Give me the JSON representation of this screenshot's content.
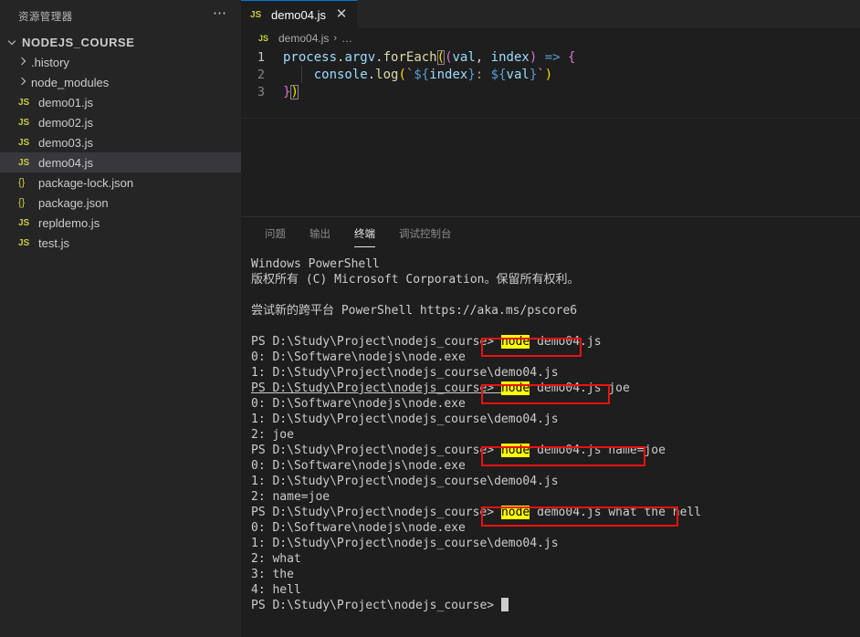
{
  "sidebar": {
    "title": "资源管理器",
    "more_icon": "ellipsis-icon",
    "root": {
      "label": "NODEJS_COURSE",
      "expanded": true
    },
    "items": [
      {
        "label": ".history",
        "kind": "folder",
        "icon": "chevron-right-icon"
      },
      {
        "label": "node_modules",
        "kind": "folder",
        "icon": "chevron-right-icon"
      },
      {
        "label": "demo01.js",
        "kind": "js",
        "icon": "js-file-icon",
        "badge": "JS"
      },
      {
        "label": "demo02.js",
        "kind": "js",
        "icon": "js-file-icon",
        "badge": "JS"
      },
      {
        "label": "demo03.js",
        "kind": "js",
        "icon": "js-file-icon",
        "badge": "JS"
      },
      {
        "label": "demo04.js",
        "kind": "js",
        "icon": "js-file-icon",
        "badge": "JS",
        "selected": true
      },
      {
        "label": "package-lock.json",
        "kind": "json",
        "icon": "json-file-icon",
        "badge": "{}"
      },
      {
        "label": "package.json",
        "kind": "json",
        "icon": "json-file-icon",
        "badge": "{}"
      },
      {
        "label": "repldemo.js",
        "kind": "js",
        "icon": "js-file-icon",
        "badge": "JS"
      },
      {
        "label": "test.js",
        "kind": "js",
        "icon": "js-file-icon",
        "badge": "JS"
      }
    ]
  },
  "editor": {
    "tab": {
      "label": "demo04.js",
      "badge": "JS",
      "close_icon": "close-icon",
      "active": true
    },
    "breadcrumb": {
      "badge": "JS",
      "file": "demo04.js",
      "separator": "›",
      "dots": "…"
    },
    "lines": [
      {
        "num": "1",
        "active": true
      },
      {
        "num": "2",
        "active": false
      },
      {
        "num": "3",
        "active": false
      }
    ],
    "code": {
      "line1": "process.argv.forEach((val, index) => {",
      "line2": "    console.log(`${index}: ${val}`)",
      "line3": "})"
    }
  },
  "panel": {
    "tabs": [
      {
        "label": "问题",
        "active": false
      },
      {
        "label": "输出",
        "active": false
      },
      {
        "label": "终端",
        "active": true
      },
      {
        "label": "调试控制台",
        "active": false
      }
    ]
  },
  "terminal": {
    "lines": [
      {
        "text": "Windows PowerShell"
      },
      {
        "text": "版权所有 (C) Microsoft Corporation。保留所有权利。"
      },
      {
        "text": ""
      },
      {
        "text": "尝试新的跨平台 PowerShell https://aka.ms/pscore6"
      },
      {
        "text": ""
      },
      {
        "prompt": "PS D:\\Study\\Project\\nodejs_course> ",
        "cmd_kw": "node",
        "cmd_rest": " demo04.js",
        "boxed": true
      },
      {
        "text": "0: D:\\Software\\nodejs\\node.exe"
      },
      {
        "text": "1: D:\\Study\\Project\\nodejs_course\\demo04.js"
      },
      {
        "prompt": "PS D:\\Study\\Project\\nodejs_course> ",
        "cmd_kw": "node",
        "cmd_rest": " demo04.js joe",
        "boxed": true,
        "underline_path": true
      },
      {
        "text": "0: D:\\Software\\nodejs\\node.exe"
      },
      {
        "text": "1: D:\\Study\\Project\\nodejs_course\\demo04.js"
      },
      {
        "text": "2: joe"
      },
      {
        "prompt": "PS D:\\Study\\Project\\nodejs_course> ",
        "cmd_kw": "node",
        "cmd_rest": " demo04.js name=joe",
        "boxed": true
      },
      {
        "text": "0: D:\\Software\\nodejs\\node.exe"
      },
      {
        "text": "1: D:\\Study\\Project\\nodejs_course\\demo04.js"
      },
      {
        "text": "2: name=joe"
      },
      {
        "prompt": "PS D:\\Study\\Project\\nodejs_course> ",
        "cmd_kw": "node",
        "cmd_rest": " demo04.js what the hell",
        "boxed": true
      },
      {
        "text": "0: D:\\Software\\nodejs\\node.exe"
      },
      {
        "text": "1: D:\\Study\\Project\\nodejs_course\\demo04.js"
      },
      {
        "text": "2: what"
      },
      {
        "text": "3: the"
      },
      {
        "text": "4: hell"
      },
      {
        "prompt_only": "PS D:\\Study\\Project\\nodejs_course> ",
        "cursor": true
      }
    ]
  },
  "colors": {
    "accent": "#0078d4",
    "sidebar_bg": "#252526",
    "editor_bg": "#1e1e1e",
    "selected_row": "#37373d",
    "annotation_red": "#ee1111",
    "highlight_yellow": "#ffff00",
    "js_icon": "#cbcb41"
  }
}
